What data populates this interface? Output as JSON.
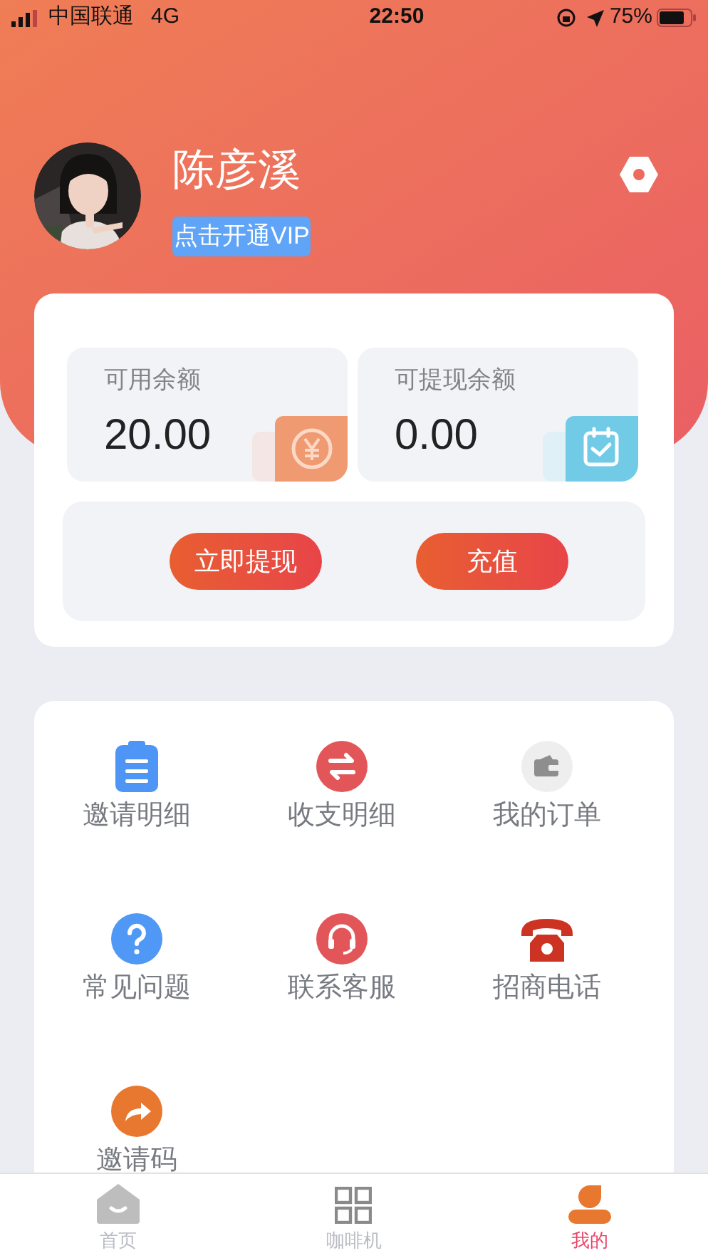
{
  "status_bar": {
    "carrier": "中国联通",
    "network": "4G",
    "time": "22:50",
    "battery": "75%"
  },
  "profile": {
    "name": "陈彦溪",
    "vip_badge": "点击开通VIP"
  },
  "balances": [
    {
      "label": "可用余额",
      "amount": "20.00",
      "kind": "yen"
    },
    {
      "label": "可提现余额",
      "amount": "0.00",
      "kind": "calendar"
    }
  ],
  "actions": [
    "立即提现",
    "充值"
  ],
  "menu": [
    {
      "label": "邀请明细",
      "kind": "clipboard"
    },
    {
      "label": "收支明细",
      "kind": "exchange"
    },
    {
      "label": "我的订单",
      "kind": "wallet"
    },
    {
      "label": "常见问题",
      "kind": "question"
    },
    {
      "label": "联系客服",
      "kind": "headset"
    },
    {
      "label": "招商电话",
      "kind": "phone"
    },
    {
      "label": "邀请码",
      "kind": "share"
    }
  ],
  "tab_bar": [
    {
      "label": "首页",
      "kind": "home",
      "selected": false
    },
    {
      "label": "咖啡机",
      "kind": "grid",
      "selected": false
    },
    {
      "label": "我的",
      "kind": "person",
      "selected": true
    }
  ]
}
